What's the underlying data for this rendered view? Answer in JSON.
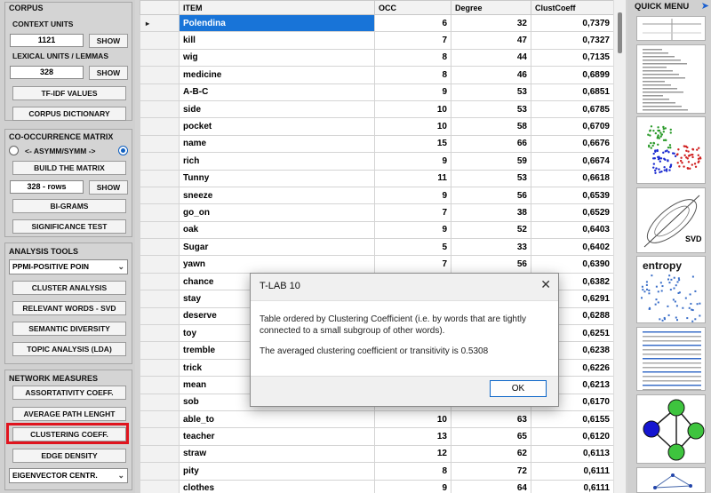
{
  "left": {
    "corpus": {
      "title": "CORPUS",
      "context_units_label": "CONTEXT UNITS",
      "context_units_value": "1121",
      "show_label": "SHOW",
      "lexical_label": "LEXICAL UNITS / LEMMAS",
      "lexical_value": "328",
      "tfidf_label": "TF-IDF VALUES",
      "dictionary_label": "CORPUS DICTIONARY"
    },
    "cooc": {
      "title": "CO-OCCURRENCE MATRIX",
      "asym_label": "<- ASYMM/SYMM ->",
      "build_label": "BUILD THE MATRIX",
      "rows_value": "328 - rows",
      "show_label": "SHOW",
      "bigrams_label": "BI-GRAMS",
      "significance_label": "SIGNIFICANCE TEST"
    },
    "analysis": {
      "title": "ANALYSIS TOOLS",
      "dropdown_value": "PPMI-POSITIVE POIN",
      "cluster_label": "CLUSTER ANALYSIS",
      "relevant_label": "RELEVANT WORDS - SVD",
      "semantic_label": "SEMANTIC DIVERSITY",
      "topic_label": "TOPIC ANALYSIS (LDA)"
    },
    "network": {
      "title": "NETWORK MEASURES",
      "assort_label": "ASSORTATIVITY COEFF.",
      "avgpath_label": "AVERAGE PATH LENGHT",
      "clustering_label": "CLUSTERING COEFF.",
      "edge_label": "EDGE DENSITY",
      "eigen_value": "EIGENVECTOR CENTR."
    }
  },
  "table": {
    "columns": [
      "ITEM",
      "OCC",
      "Degree",
      "ClustCoeff"
    ],
    "rows": [
      [
        "Polendina",
        "6",
        "32",
        "0,7379"
      ],
      [
        "kill",
        "7",
        "47",
        "0,7327"
      ],
      [
        "wig",
        "8",
        "44",
        "0,7135"
      ],
      [
        "medicine",
        "8",
        "46",
        "0,6899"
      ],
      [
        "A-B-C",
        "9",
        "53",
        "0,6851"
      ],
      [
        "side",
        "10",
        "53",
        "0,6785"
      ],
      [
        "pocket",
        "10",
        "58",
        "0,6709"
      ],
      [
        "name",
        "15",
        "66",
        "0,6676"
      ],
      [
        "rich",
        "9",
        "59",
        "0,6674"
      ],
      [
        "Tunny",
        "11",
        "53",
        "0,6618"
      ],
      [
        "sneeze",
        "9",
        "56",
        "0,6539"
      ],
      [
        "go_on",
        "7",
        "38",
        "0,6529"
      ],
      [
        "oak",
        "9",
        "52",
        "0,6403"
      ],
      [
        "Sugar",
        "5",
        "33",
        "0,6402"
      ],
      [
        "yawn",
        "7",
        "56",
        "0,6390"
      ],
      [
        "chance",
        "",
        "",
        "0,6382"
      ],
      [
        "stay",
        "",
        "",
        "0,6291"
      ],
      [
        "deserve",
        "",
        "",
        "0,6288"
      ],
      [
        "toy",
        "",
        "",
        "0,6251"
      ],
      [
        "tremble",
        "",
        "",
        "0,6238"
      ],
      [
        "trick",
        "",
        "",
        "0,6226"
      ],
      [
        "mean",
        "",
        "",
        "0,6213"
      ],
      [
        "sob",
        "",
        "",
        "0,6170"
      ],
      [
        "able_to",
        "10",
        "63",
        "0,6155"
      ],
      [
        "teacher",
        "13",
        "65",
        "0,6120"
      ],
      [
        "straw",
        "12",
        "62",
        "0,6113"
      ],
      [
        "pity",
        "8",
        "72",
        "0,6111"
      ],
      [
        "clothes",
        "9",
        "64",
        "0,6111"
      ]
    ]
  },
  "right": {
    "title": "QUICK MENU",
    "thumbs": [
      {
        "label": "",
        "icon": "table-thumbnail"
      },
      {
        "label": "",
        "icon": "list-thumbnail"
      },
      {
        "label": "",
        "icon": "scatter-clusters-thumbnail"
      },
      {
        "label": "SVD",
        "icon": "svd-ellipse-thumbnail"
      },
      {
        "label": "entropy",
        "icon": "entropy-matrix-thumbnail"
      },
      {
        "label": "",
        "icon": "report-thumbnail"
      },
      {
        "label": "",
        "icon": "network-graph-thumbnail"
      },
      {
        "label": "",
        "icon": "network-small-thumbnail"
      }
    ]
  },
  "dialog": {
    "title": "T-LAB 10",
    "message": "Table ordered by Clustering Coefficient (i.e. by words that are tightly connected to a small subgroup of other words).",
    "message2": "The averaged clustering coefficient or transitivity is  0.5308",
    "ok_label": "OK"
  },
  "colors": {
    "selection": "#1874d8",
    "highlight_border": "#e0141e",
    "node_green": "#3ec43e",
    "node_blue": "#1515d0"
  }
}
